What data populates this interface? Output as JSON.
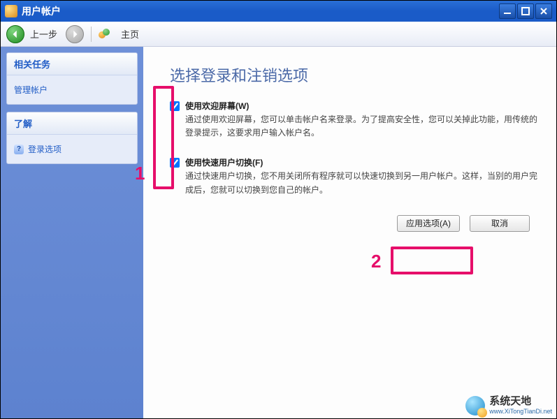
{
  "window": {
    "title": "用户帐户"
  },
  "toolbar": {
    "back_label": "上一步",
    "home_label": "主页"
  },
  "sidebar": {
    "tasks": {
      "header": "相关任务",
      "items": [
        "管理帐户"
      ]
    },
    "learn": {
      "header": "了解",
      "items": [
        "登录选项"
      ]
    }
  },
  "content": {
    "heading": "选择登录和注销选项",
    "options": [
      {
        "title": "使用欢迎屏幕(W)",
        "desc": "通过使用欢迎屏幕，您可以单击帐户名来登录。为了提高安全性，您可以关掉此功能，用传统的登录提示，这要求用户输入帐户名。",
        "checked": true
      },
      {
        "title": "使用快速用户切换(F)",
        "desc": "通过快速用户切换，您不用关闭所有程序就可以快速切换到另一用户帐户。这样，当别的用户完成后，您就可以切换到您自己的帐户。",
        "checked": true
      }
    ],
    "apply_label": "应用选项(A)",
    "cancel_label": "取消"
  },
  "annotations": {
    "n1": "1",
    "n2": "2"
  },
  "watermark": {
    "line1": "系统天地",
    "line2": "www.XiTongTianDi.net"
  }
}
